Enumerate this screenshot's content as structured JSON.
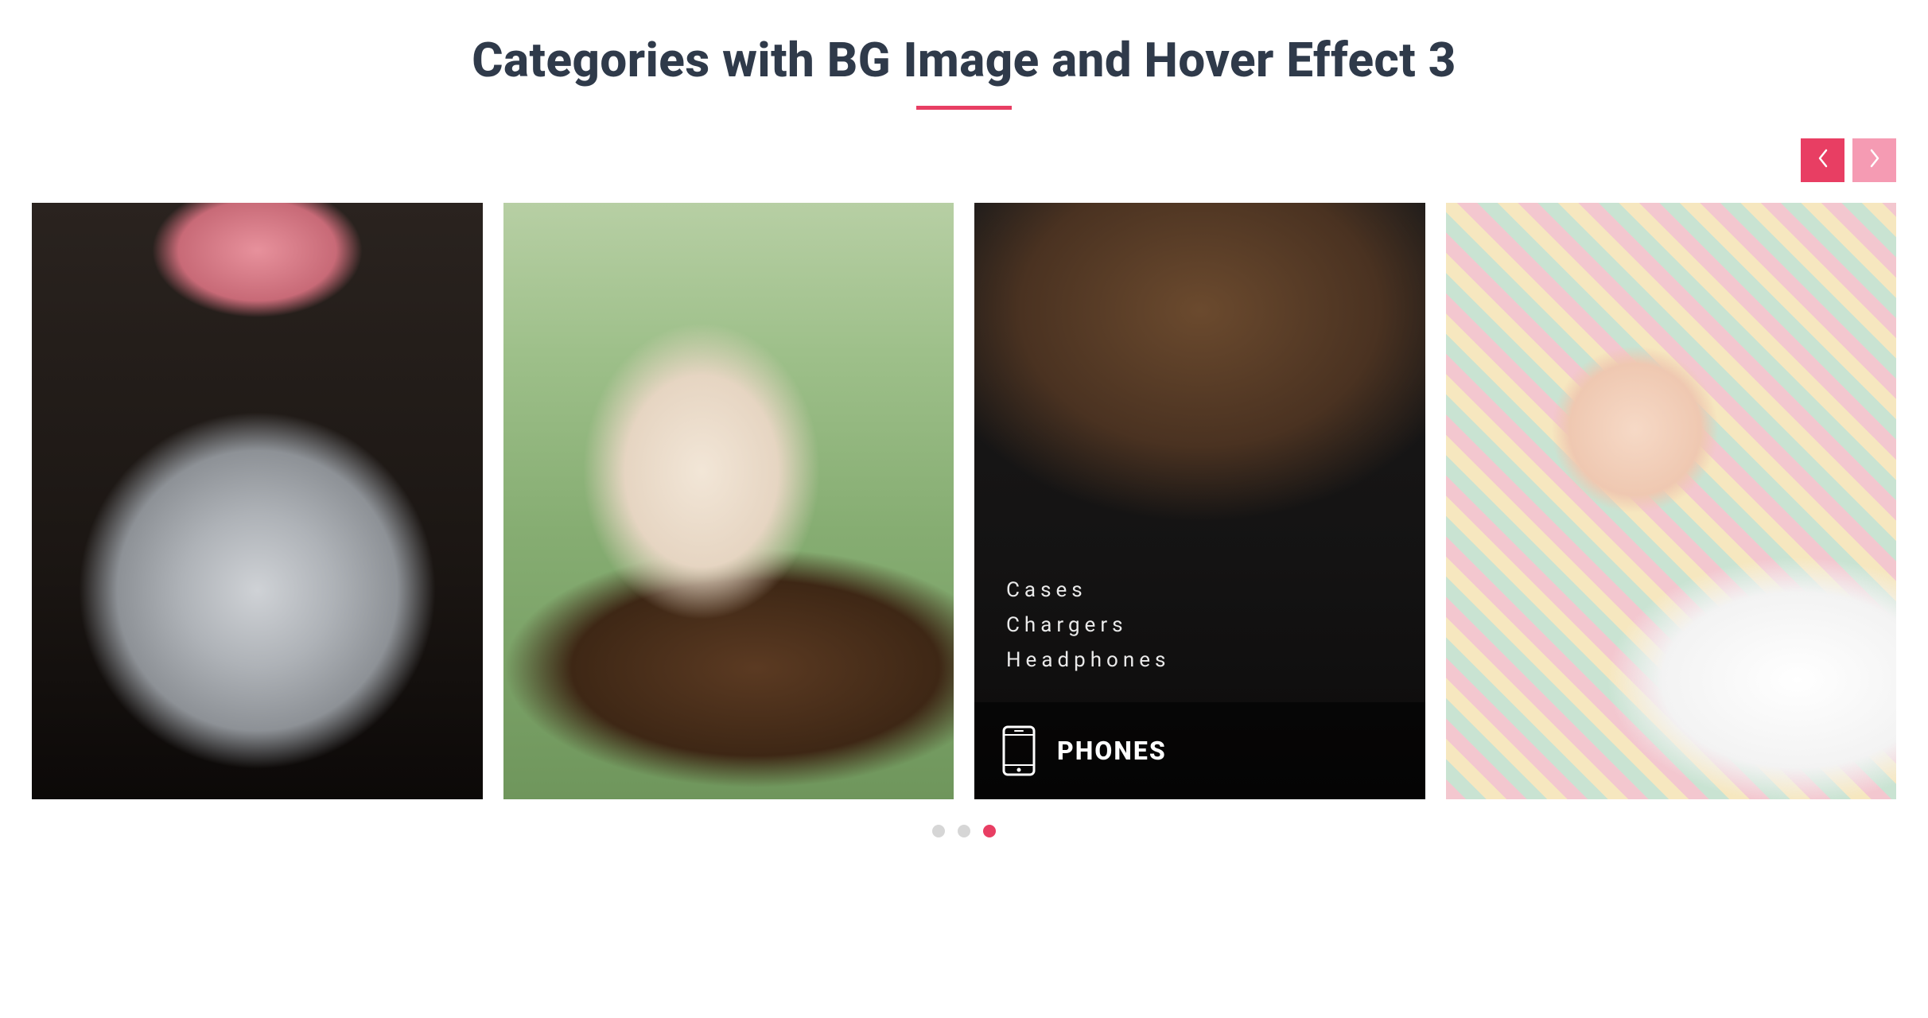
{
  "title": "Categories with BG Image and Hover Effect 3",
  "colors": {
    "accent": "#e83e63",
    "accent_light": "#f59bb3",
    "title": "#2f3a4a"
  },
  "nav": {
    "prev_name": "carousel-prev-button",
    "next_name": "carousel-next-button"
  },
  "carousel": {
    "active_dot_index": 2,
    "dot_count": 3,
    "cards": [
      {
        "image_name": "jewelry-necklace-image",
        "hovered": false
      },
      {
        "image_name": "woman-guitar-image",
        "hovered": false
      },
      {
        "image_name": "bag-tie-phone-image",
        "hovered": true,
        "footer": {
          "icon_name": "phone-icon",
          "label": "PHONES"
        },
        "subcategories": [
          "Cases",
          "Chargers",
          "Headphones"
        ]
      },
      {
        "image_name": "baby-toys-image",
        "hovered": false
      }
    ]
  }
}
